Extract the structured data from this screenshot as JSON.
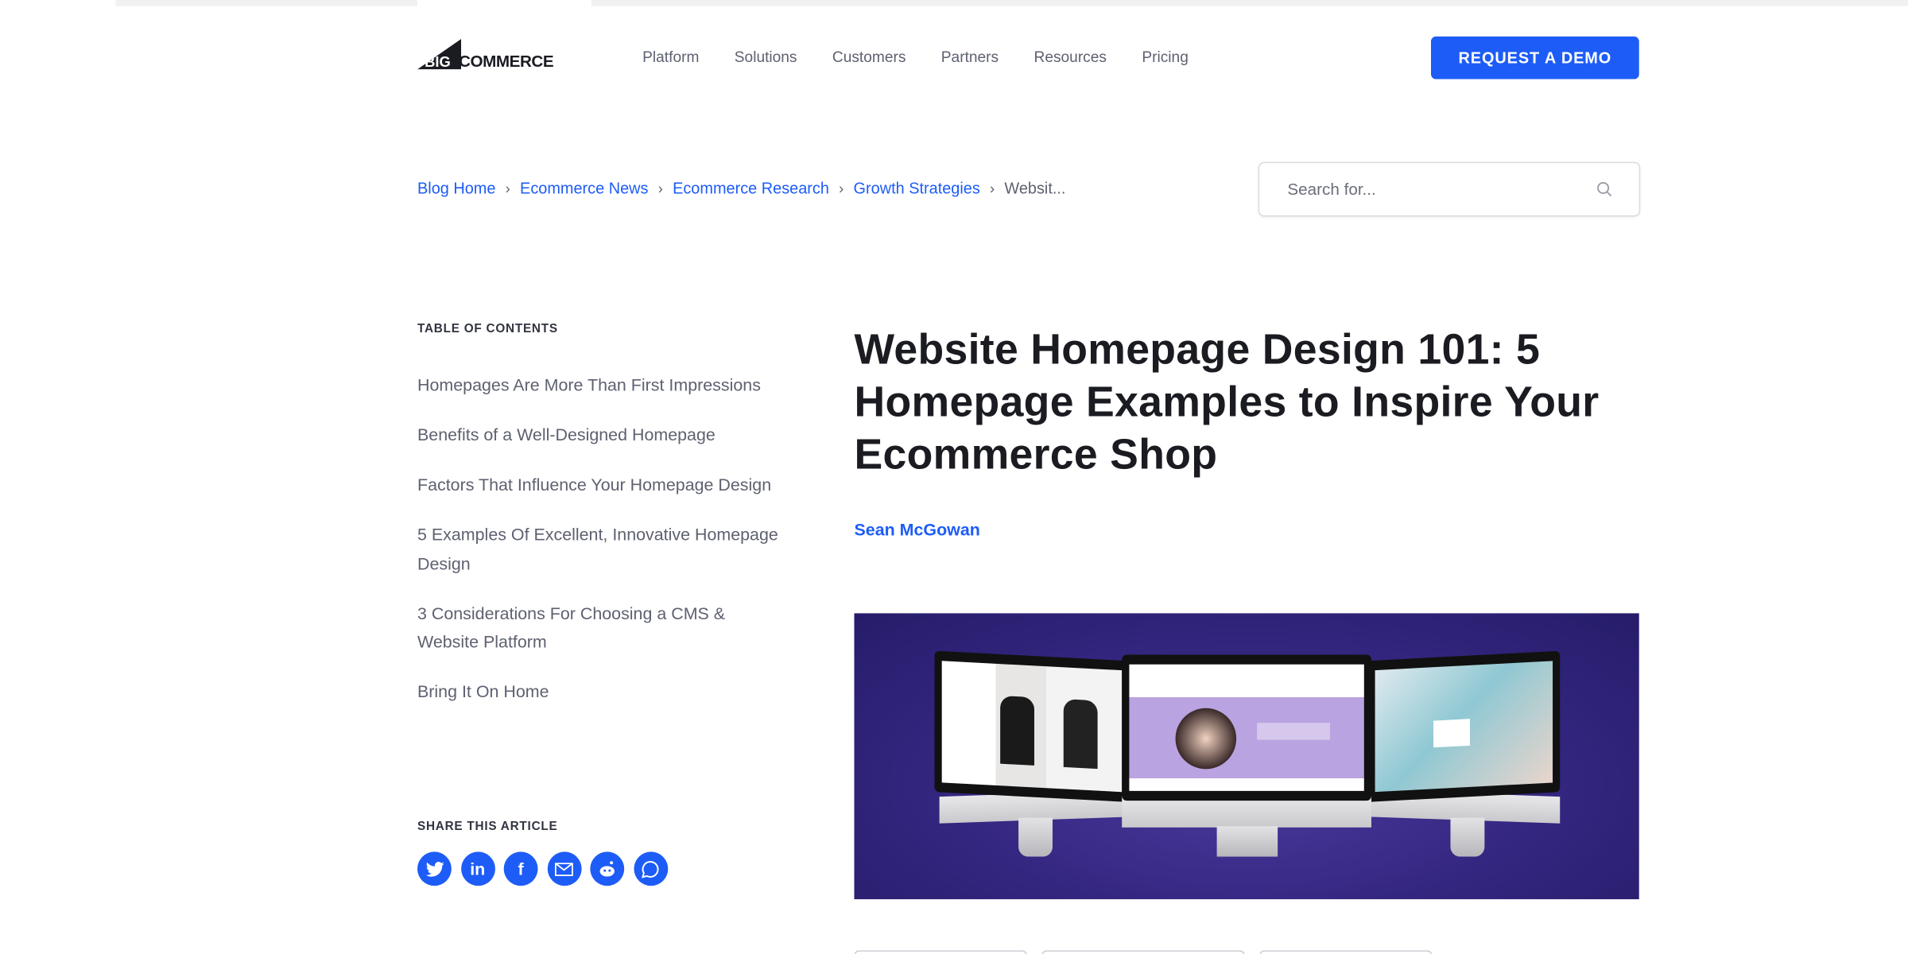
{
  "brand": {
    "logo_text": "BIGCOMMERCE",
    "accent": "#1d5cf6"
  },
  "nav": {
    "items": [
      "Platform",
      "Solutions",
      "Customers",
      "Partners",
      "Resources",
      "Pricing"
    ],
    "cta": "REQUEST A DEMO"
  },
  "breadcrumb": {
    "items": [
      "Blog Home",
      "Ecommerce News",
      "Ecommerce Research",
      "Growth Strategies"
    ],
    "current": "Websit..."
  },
  "search": {
    "placeholder": "Search for...",
    "icon": "search-icon"
  },
  "toc": {
    "heading": "TABLE OF CONTENTS",
    "items": [
      "Homepages Are More Than First Impressions",
      "Benefits of a Well-Designed Homepage",
      "Factors That Influence Your Homepage Design",
      "5 Examples Of Excellent, Innovative Homepage Design",
      "3 Considerations For Choosing a CMS & Website Platform",
      "Bring It On Home"
    ]
  },
  "share": {
    "heading": "SHARE THIS ARTICLE",
    "icons": [
      "twitter-icon",
      "linkedin-icon",
      "facebook-icon",
      "email-icon",
      "reddit-icon",
      "whatsapp-icon"
    ]
  },
  "article": {
    "title": "Website Homepage Design 101: 5 Homepage Examples to Inspire Your Ecommerce Shop",
    "author": "Sean McGowan"
  }
}
